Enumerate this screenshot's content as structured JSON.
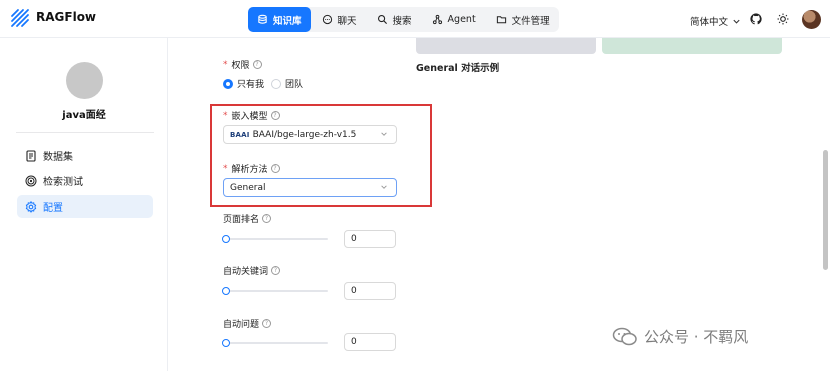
{
  "app": {
    "brand": "RAGFlow"
  },
  "nav": {
    "items": [
      {
        "label": "知识库",
        "icon": "database-icon",
        "active": true
      },
      {
        "label": "聊天",
        "icon": "chat-bubble-icon",
        "active": false
      },
      {
        "label": "搜索",
        "icon": "search-icon",
        "active": false
      },
      {
        "label": "Agent",
        "icon": "agent-graph-icon",
        "active": false
      },
      {
        "label": "文件管理",
        "icon": "folder-icon",
        "active": false
      }
    ],
    "language": "简体中文"
  },
  "sidebar": {
    "kb_name": "java面经",
    "items": [
      {
        "label": "数据集",
        "icon": "document-icon",
        "active": false
      },
      {
        "label": "检索测试",
        "icon": "target-icon",
        "active": false
      },
      {
        "label": "配置",
        "icon": "gear-icon",
        "active": true
      }
    ]
  },
  "form": {
    "permission": {
      "label": "权限",
      "options": [
        {
          "label": "只有我",
          "selected": true
        },
        {
          "label": "团队",
          "selected": false
        }
      ]
    },
    "embedding_model": {
      "label": "嵌入模型",
      "value": "BAAI/bge-large-zh-v1.5",
      "vendor_logo": "BAAI"
    },
    "parse_method": {
      "label": "解析方法",
      "value": "General"
    },
    "page_rank": {
      "label": "页面排名",
      "value": "0",
      "level": 0
    },
    "auto_keywords": {
      "label": "自动关键词",
      "value": "0",
      "level": 0
    },
    "auto_questions": {
      "label": "自动问题",
      "value": "0",
      "level": 0
    }
  },
  "preview": {
    "title": "General 对话示例"
  },
  "watermark": {
    "text": "公众号 · 不羁风"
  },
  "colors": {
    "accent": "#1677ff",
    "highlight": "#d93838",
    "required": "#e34d4d"
  }
}
